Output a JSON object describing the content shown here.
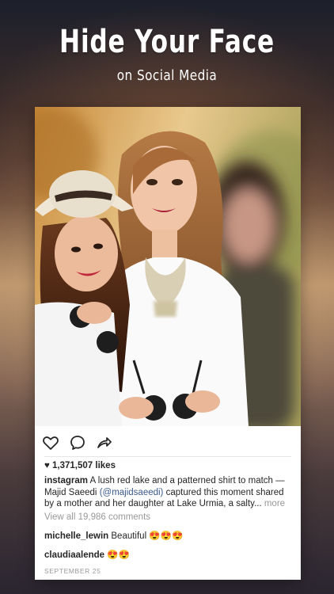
{
  "promo": {
    "headline": "Hide Your Face",
    "subline": "on Social Media"
  },
  "post": {
    "likes": "1,371,507 likes",
    "caption": {
      "username": "instagram",
      "text_before": " A lush red lake and a patterned shirt to match — Majid Saeedi ",
      "mention": "(@majidsaeedi)",
      "text_after": " captured this moment shared by a mother and her daughter at Lake Urmia, a salty...",
      "more": " more"
    },
    "view_all": "View all 19,986 comments",
    "comments": [
      {
        "username": "michelle_lewin",
        "text": " Beautiful 😍😍😍"
      },
      {
        "username": "claudiaalende",
        "text": " 😍😍"
      }
    ],
    "date": "SEPTEMBER 25"
  },
  "icons": {
    "like": "heart-outline-icon",
    "comment": "comment-bubble-icon",
    "share": "share-arrow-icon"
  }
}
